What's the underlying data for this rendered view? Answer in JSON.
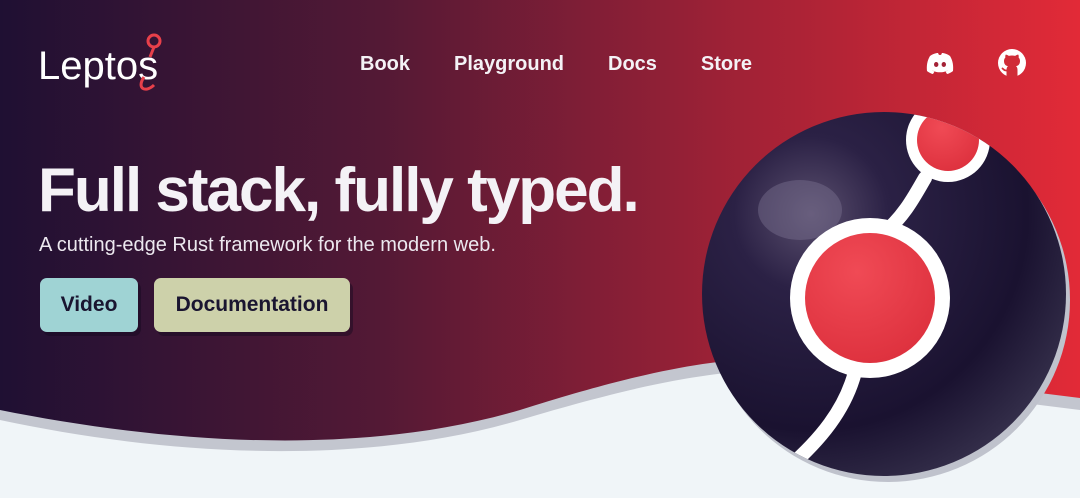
{
  "brand": {
    "logo_text": "Leptos"
  },
  "nav": {
    "links": [
      {
        "label": "Book"
      },
      {
        "label": "Playground"
      },
      {
        "label": "Docs"
      },
      {
        "label": "Store"
      }
    ],
    "icons": [
      {
        "icon": "discord-icon"
      },
      {
        "icon": "github-icon"
      }
    ]
  },
  "hero": {
    "headline": "Full stack, fully typed.",
    "subtitle": "A cutting-edge Rust framework for the modern web.",
    "buttons": {
      "video_label": "Video",
      "docs_label": "Documentation"
    }
  },
  "colors": {
    "gradient_start": "#1f1033",
    "gradient_end": "#e22a37",
    "footer_bg": "#f0f5f8",
    "accent_red": "#ea3c48",
    "button_video": "#9fd3d4",
    "button_docs": "#cdd1aa"
  }
}
